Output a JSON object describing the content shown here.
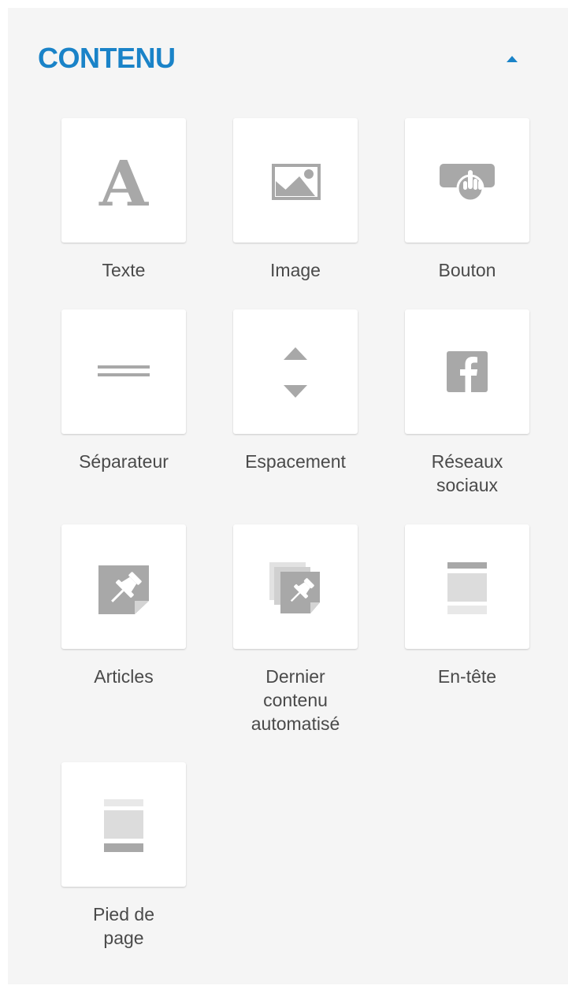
{
  "panel": {
    "title": "CONTENU",
    "accent_color": "#1a83c8",
    "collapse_icon": "caret-up-icon"
  },
  "blocks": [
    {
      "label": "Texte",
      "icon": "text-icon"
    },
    {
      "label": "Image",
      "icon": "image-icon"
    },
    {
      "label": "Bouton",
      "icon": "button-click-icon"
    },
    {
      "label": "Séparateur",
      "icon": "divider-icon"
    },
    {
      "label": "Espacement",
      "icon": "spacer-icon"
    },
    {
      "label": "Réseaux\nsociaux",
      "icon": "facebook-icon"
    },
    {
      "label": "Articles",
      "icon": "pin-article-icon"
    },
    {
      "label": "Dernier\ncontenu\nautomatisé",
      "icon": "stacked-articles-icon"
    },
    {
      "label": "En-tête",
      "icon": "header-layout-icon"
    },
    {
      "label": "Pied de\npage",
      "icon": "footer-layout-icon"
    }
  ],
  "colors": {
    "icon_gray": "#a8a8a8",
    "icon_light_gray": "#dcdcdc",
    "label_text": "#4a4a4a",
    "panel_bg": "#f5f5f5"
  }
}
